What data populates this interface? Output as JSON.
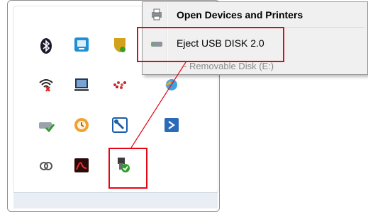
{
  "context_menu": {
    "items": [
      {
        "label": "Open Devices and Printers",
        "icon": "devices-printers-icon"
      },
      {
        "label": "Eject USB DISK 2.0",
        "icon": "usb-drive-icon"
      }
    ],
    "sub_info": "- Removable Disk (E:)"
  },
  "tray": {
    "icons": [
      "bluetooth-icon",
      "network-share-icon",
      "security-shield-icon",
      "wifi-disconnected-icon",
      "laptop-display-icon",
      "colorful-dots-icon",
      "sync-icon",
      "drive-check-icon",
      "backup-icon",
      "tools-icon",
      "terminal-icon",
      "creative-cloud-icon",
      "pdf-reader-icon",
      "safely-remove-hardware-icon"
    ]
  },
  "colors": {
    "highlight": "#e30613",
    "menu_bg": "#f0f0f0"
  }
}
